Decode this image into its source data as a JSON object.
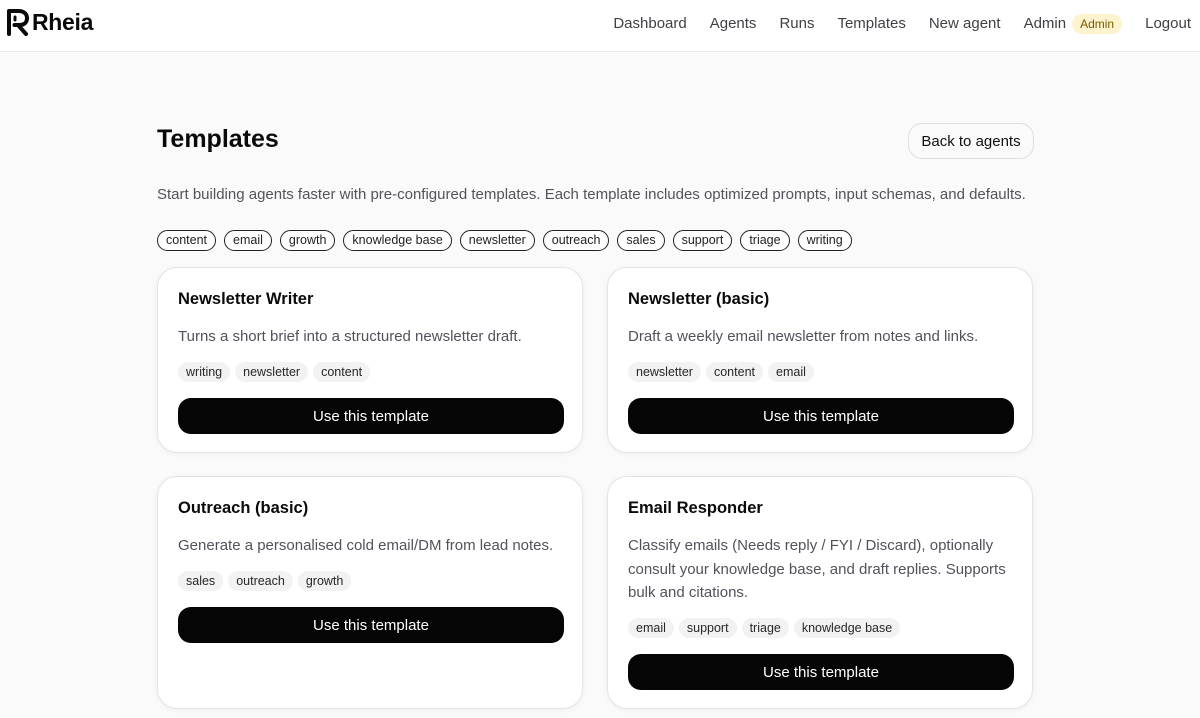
{
  "header": {
    "logo_text": "Rheia",
    "nav": {
      "dashboard": "Dashboard",
      "agents": "Agents",
      "runs": "Runs",
      "templates": "Templates",
      "new_agent": "New agent",
      "admin": "Admin",
      "admin_badge": "Admin",
      "logout": "Logout"
    }
  },
  "page": {
    "title": "Templates",
    "back_label": "Back to agents",
    "intro": "Start building agents faster with pre-configured templates. Each template includes optimized prompts, input schemas, and defaults.",
    "filters": [
      "content",
      "email",
      "growth",
      "knowledge base",
      "newsletter",
      "outreach",
      "sales",
      "support",
      "triage",
      "writing"
    ]
  },
  "templates": [
    {
      "title": "Newsletter Writer",
      "description": "Turns a short brief into a structured newsletter draft.",
      "tags": [
        "writing",
        "newsletter",
        "content"
      ],
      "button": "Use this template"
    },
    {
      "title": "Newsletter (basic)",
      "description": "Draft a weekly email newsletter from notes and links.",
      "tags": [
        "newsletter",
        "content",
        "email"
      ],
      "button": "Use this template"
    },
    {
      "title": "Outreach (basic)",
      "description": "Generate a personalised cold email/DM from lead notes.",
      "tags": [
        "sales",
        "outreach",
        "growth"
      ],
      "button": "Use this template"
    },
    {
      "title": "Email Responder",
      "description": "Classify emails (Needs reply / FYI / Discard), optionally consult your knowledge base, and draft replies. Supports bulk and citations.",
      "tags": [
        "email",
        "support",
        "triage",
        "knowledge base"
      ],
      "button": "Use this template"
    }
  ],
  "colors": {
    "background": "#fafafa",
    "card": "#ffffff",
    "primary_button": "#050505",
    "admin_badge_bg": "#fdf3cf",
    "tag_bg": "#f2f2f3"
  }
}
